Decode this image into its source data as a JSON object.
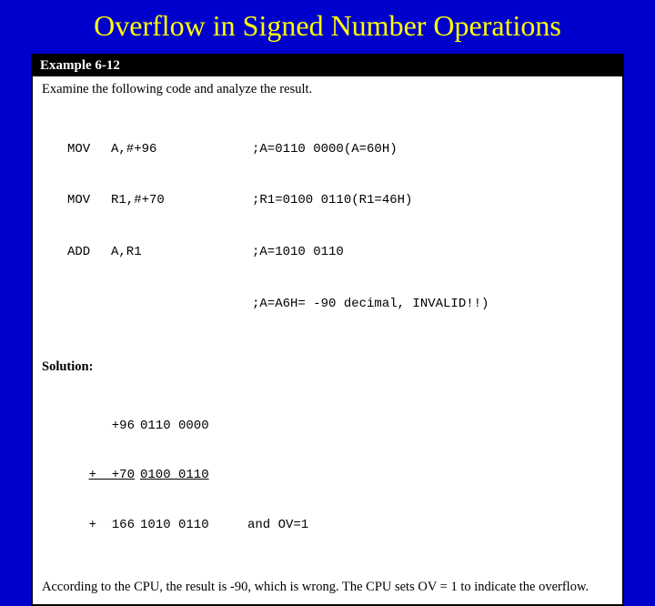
{
  "title": "Overflow in Signed Number Operations",
  "example_label": "Example 6-12",
  "prompt": "Examine the following code and analyze the result.",
  "code": {
    "rows": [
      {
        "op": "MOV",
        "arg": "A,#+96",
        "cmt": ";A=0110 0000(A=60H)"
      },
      {
        "op": "MOV",
        "arg": "R1,#+70",
        "cmt": ";R1=0100 0110(R1=46H)"
      },
      {
        "op": "ADD",
        "arg": "A,R1",
        "cmt": ";A=1010 0110"
      },
      {
        "op": "",
        "arg": "",
        "cmt": ";A=A6H= -90 decimal, INVALID!!)"
      }
    ]
  },
  "solution_label": "Solution:",
  "math": {
    "rows": [
      {
        "left": "+96",
        "bits": "0110 0000",
        "tail": "",
        "u_left": false,
        "u_bits": false
      },
      {
        "left": "+  +70",
        "bits": "0100 0110",
        "tail": "",
        "u_left": true,
        "u_bits": true
      },
      {
        "left": "+  166",
        "bits": "1010 0110",
        "tail": "and OV=1",
        "u_left": false,
        "u_bits": false
      }
    ]
  },
  "conclusion": "According to the CPU, the result is -90, which is wrong.  The CPU sets OV = 1 to indicate the overflow."
}
